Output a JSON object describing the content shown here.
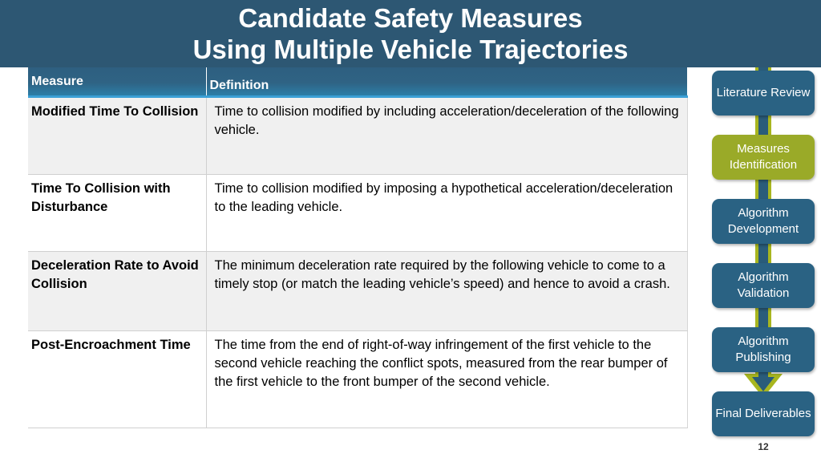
{
  "slide": {
    "title_line1": "Candidate Safety Measures",
    "title_line2": "Using Multiple Vehicle Trajectories",
    "page_number": "12",
    "colors": {
      "banner": "#2d5773",
      "header_row": "#2f6384",
      "header_underline": "#3ba0d6",
      "row_alt": "#f0f0f0",
      "row_plain": "#ffffff",
      "flow_blue": "#2a6283",
      "flow_olive": "#9aaa28",
      "connector": "#a8b61f"
    }
  },
  "table": {
    "columns": [
      "Measure",
      "Definition"
    ],
    "rows": [
      {
        "measure": "Modified Time To Collision",
        "definition": "Time to collision modified by including acceleration/deceleration of the following vehicle."
      },
      {
        "measure": "Time To Collision with Disturbance",
        "definition": "Time to collision modified by imposing a hypothetical acceleration/deceleration to the leading vehicle."
      },
      {
        "measure": "Deceleration Rate to Avoid Collision",
        "definition": "The minimum deceleration rate required by the following vehicle to come to a timely stop (or match the leading vehicle’s speed) and hence to avoid a crash."
      },
      {
        "measure": "Post-Encroachment Time",
        "definition": "The time from the end of right-of-way infringement of the first vehicle to the second vehicle reaching the conflict spots, measured from the rear bumper of the first vehicle to the front bumper of the second vehicle."
      }
    ]
  },
  "flowchart": {
    "steps": [
      {
        "label": "Literature Review",
        "style": "blue"
      },
      {
        "label": "Measures Identification",
        "style": "olive"
      },
      {
        "label": "Algorithm Development",
        "style": "blue"
      },
      {
        "label": "Algorithm Validation",
        "style": "blue"
      },
      {
        "label": "Algorithm Publishing",
        "style": "blue"
      },
      {
        "label": "Final Deliverables",
        "style": "blue"
      }
    ]
  }
}
